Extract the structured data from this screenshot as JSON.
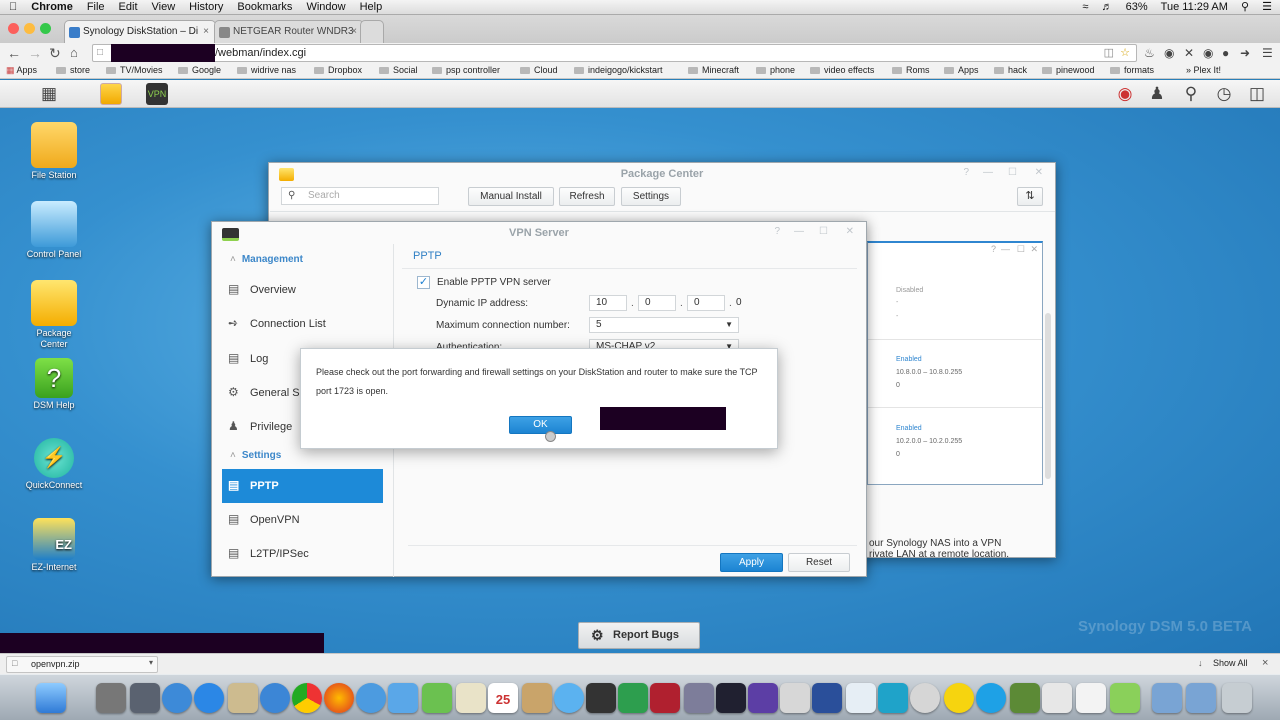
{
  "menubar": {
    "apple": "",
    "app": "Chrome",
    "items": [
      "File",
      "Edit",
      "View",
      "History",
      "Bookmarks",
      "Window",
      "Help"
    ],
    "battery": "63%",
    "clock": "Tue 11:29 AM"
  },
  "tabs": [
    {
      "title": "Synology DiskStation – Di",
      "close": "×"
    },
    {
      "title": "NETGEAR Router WNDR3",
      "close": "×"
    }
  ],
  "address": {
    "url": "/webman/index.cgi"
  },
  "bookmarks": {
    "apps": "Apps",
    "items": [
      "store",
      "TV/Movies",
      "Google",
      "widrive nas",
      "Dropbox",
      "Social",
      "psp controller",
      "Cloud",
      "indeigogo/kickstart",
      "Minecraft",
      "phone",
      "video effects",
      "Roms",
      "Apps",
      "hack",
      "pinewood",
      "formats"
    ],
    "more": "» Plex It!"
  },
  "desktop_icons": [
    {
      "label": "File Station"
    },
    {
      "label": "Control Panel"
    },
    {
      "label": "Package Center"
    },
    {
      "label": "DSM Help"
    },
    {
      "label": "QuickConnect"
    },
    {
      "label": "EZ-Internet"
    }
  ],
  "package_center": {
    "title": "Package Center",
    "search_placeholder": "Search",
    "manual_install": "Manual Install",
    "refresh": "Refresh",
    "settings": "Settings",
    "status_disabled": "Disabled",
    "dash": "-",
    "enabled1": "Enabled",
    "range1": "10.8.0.0 – 10.8.0.255",
    "zero1": "0",
    "enabled2": "Enabled",
    "range2": "10.2.0.0 – 10.2.0.255",
    "zero2": "0",
    "desc1": "our Synology NAS into a VPN",
    "desc2": "rivate LAN at a remote location."
  },
  "vpn_server": {
    "title": "VPN Server",
    "sidebar": {
      "management": "Management",
      "overview": "Overview",
      "connection_list": "Connection List",
      "log": "Log",
      "general": "General S",
      "privilege": "Privilege",
      "settings": "Settings",
      "pptp": "PPTP",
      "openvpn": "OpenVPN",
      "l2tp": "L2TP/IPSec"
    },
    "section": "PPTP",
    "enable_label": "Enable PPTP VPN server",
    "dyn_ip_label": "Dynamic IP address:",
    "ip": [
      "10",
      "0",
      "0",
      "0"
    ],
    "max_conn_label": "Maximum connection number:",
    "max_conn_value": "5",
    "auth_label": "Authentication:",
    "auth_value": "MS-CHAP v2",
    "apply": "Apply",
    "reset": "Reset"
  },
  "modal": {
    "message": "Please check out the port forwarding and firewall settings on your DiskStation and router to make sure the TCP port 1723 is open.",
    "ok": "OK"
  },
  "report_bugs": "Report Bugs",
  "watermark": "Synology DSM 5.0 BETA",
  "download": {
    "file": "openvpn.zip",
    "show_all": "Show All",
    "close": "×"
  }
}
